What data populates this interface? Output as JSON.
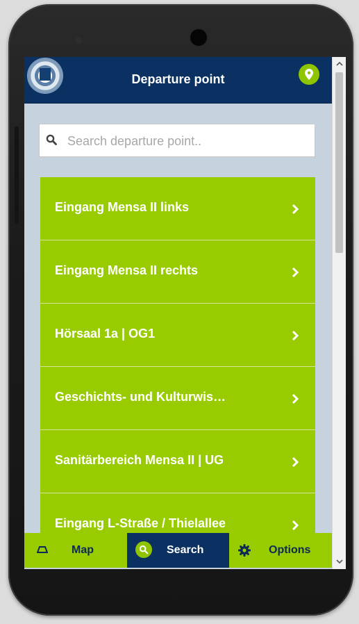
{
  "header": {
    "title": "Departure point"
  },
  "search": {
    "placeholder": "Search departure point.."
  },
  "list": {
    "items": [
      {
        "label": "Eingang Mensa II links"
      },
      {
        "label": "Eingang Mensa II rechts"
      },
      {
        "label": "Hörsaal 1a | OG1"
      },
      {
        "label": "Geschichts- und Kulturwis…"
      },
      {
        "label": "Sanitärbereich Mensa II | UG"
      },
      {
        "label": "Eingang L-Straße / Thielallee"
      }
    ]
  },
  "nav": {
    "tabs": [
      {
        "label": "Map",
        "icon": "map-icon",
        "active": false
      },
      {
        "label": "Search",
        "icon": "search-icon",
        "active": true
      },
      {
        "label": "Options",
        "icon": "gear-icon",
        "active": false
      }
    ]
  },
  "colors": {
    "header": "#0b3163",
    "accent_green": "#99cc00",
    "screen_bg": "#c6d3de"
  }
}
